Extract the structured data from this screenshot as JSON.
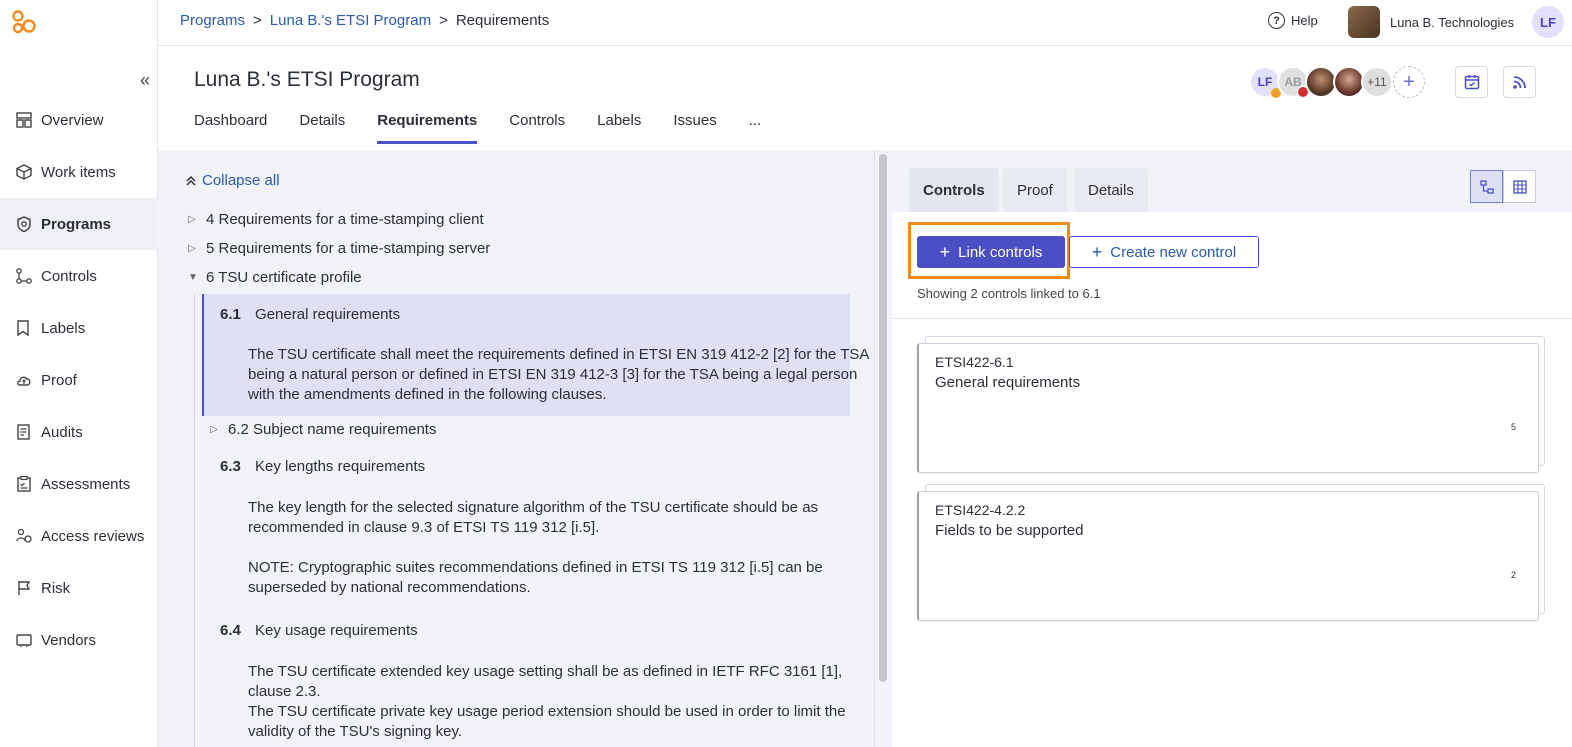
{
  "breadcrumb": {
    "programs": "Programs",
    "program": "Luna B.'s ETSI Program",
    "current": "Requirements",
    "sep1": ">",
    "sep2": ">"
  },
  "header": {
    "help": "Help",
    "org_name": "Luna B. Technologies",
    "user_initials": "LF"
  },
  "sidebar": {
    "collapse_glyph": "«",
    "items": [
      {
        "label": "Overview",
        "icon": "overview-icon"
      },
      {
        "label": "Work items",
        "icon": "package-icon"
      },
      {
        "label": "Programs",
        "icon": "shield-icon"
      },
      {
        "label": "Controls",
        "icon": "controls-icon"
      },
      {
        "label": "Labels",
        "icon": "label-icon"
      },
      {
        "label": "Proof",
        "icon": "cloud-icon"
      },
      {
        "label": "Audits",
        "icon": "audit-icon"
      },
      {
        "label": "Assessments",
        "icon": "clipboard-icon"
      },
      {
        "label": "Access reviews",
        "icon": "access-icon"
      },
      {
        "label": "Risk",
        "icon": "flag-icon"
      },
      {
        "label": "Vendors",
        "icon": "vendor-icon"
      }
    ]
  },
  "program": {
    "title": "Luna B.'s ETSI Program",
    "tabs": [
      "Dashboard",
      "Details",
      "Requirements",
      "Controls",
      "Labels",
      "Issues",
      "..."
    ],
    "members": {
      "m1": "LF",
      "m2": "AB",
      "more": "+11",
      "add": "+"
    }
  },
  "requirements": {
    "collapse_all": "Collapse all",
    "top_sections": [
      "4 Requirements for a time-stamping client",
      "5 Requirements for a time-stamping server",
      "6 TSU certificate profile"
    ],
    "s61": {
      "num": "6.1",
      "title": "General requirements",
      "lines": [
        "The TSU certificate shall meet the requirements defined in ETSI EN 319 412-2 [2] for the TSA",
        "being a natural person or defined in ETSI EN 319 412-3 [3] for the TSA being a legal person",
        "with the amendments defined in the following clauses."
      ]
    },
    "s62": "6.2 Subject name requirements",
    "s63": {
      "num": "6.3",
      "title": "Key lengths requirements",
      "lines": [
        "The key length for the selected signature algorithm of the TSU certificate should be as",
        "recommended in clause 9.3 of ETSI TS 119 312 [i.5]."
      ],
      "note_lines": [
        "NOTE: Cryptographic suites recommendations defined in ETSI TS 119 312 [i.5] can be",
        "superseded by national recommendations."
      ]
    },
    "s64": {
      "num": "6.4",
      "title": "Key usage requirements",
      "lines": [
        "The TSU certificate extended key usage setting shall be as defined in IETF RFC 3161 [1],",
        "clause 2.3.",
        "The TSU certificate private key usage period extension should be used in order to limit the",
        "validity of the TSU's signing key."
      ]
    }
  },
  "right": {
    "tabs": [
      "Controls",
      "Proof",
      "Details"
    ],
    "link_controls": "Link controls",
    "create_control": "Create new control",
    "showing": "Showing 2 controls linked to 6.1",
    "cards": [
      {
        "id": "ETSI422-6.1",
        "name": "General requirements",
        "count": "5"
      },
      {
        "id": "ETSI422-4.2.2",
        "name": "Fields to be supported",
        "count": "2"
      }
    ]
  },
  "colors": {
    "accent": "#4a4fc4",
    "highlight": "#f08a1c",
    "link": "#2c5aa8",
    "panel_bg": "#f1f3f9"
  }
}
